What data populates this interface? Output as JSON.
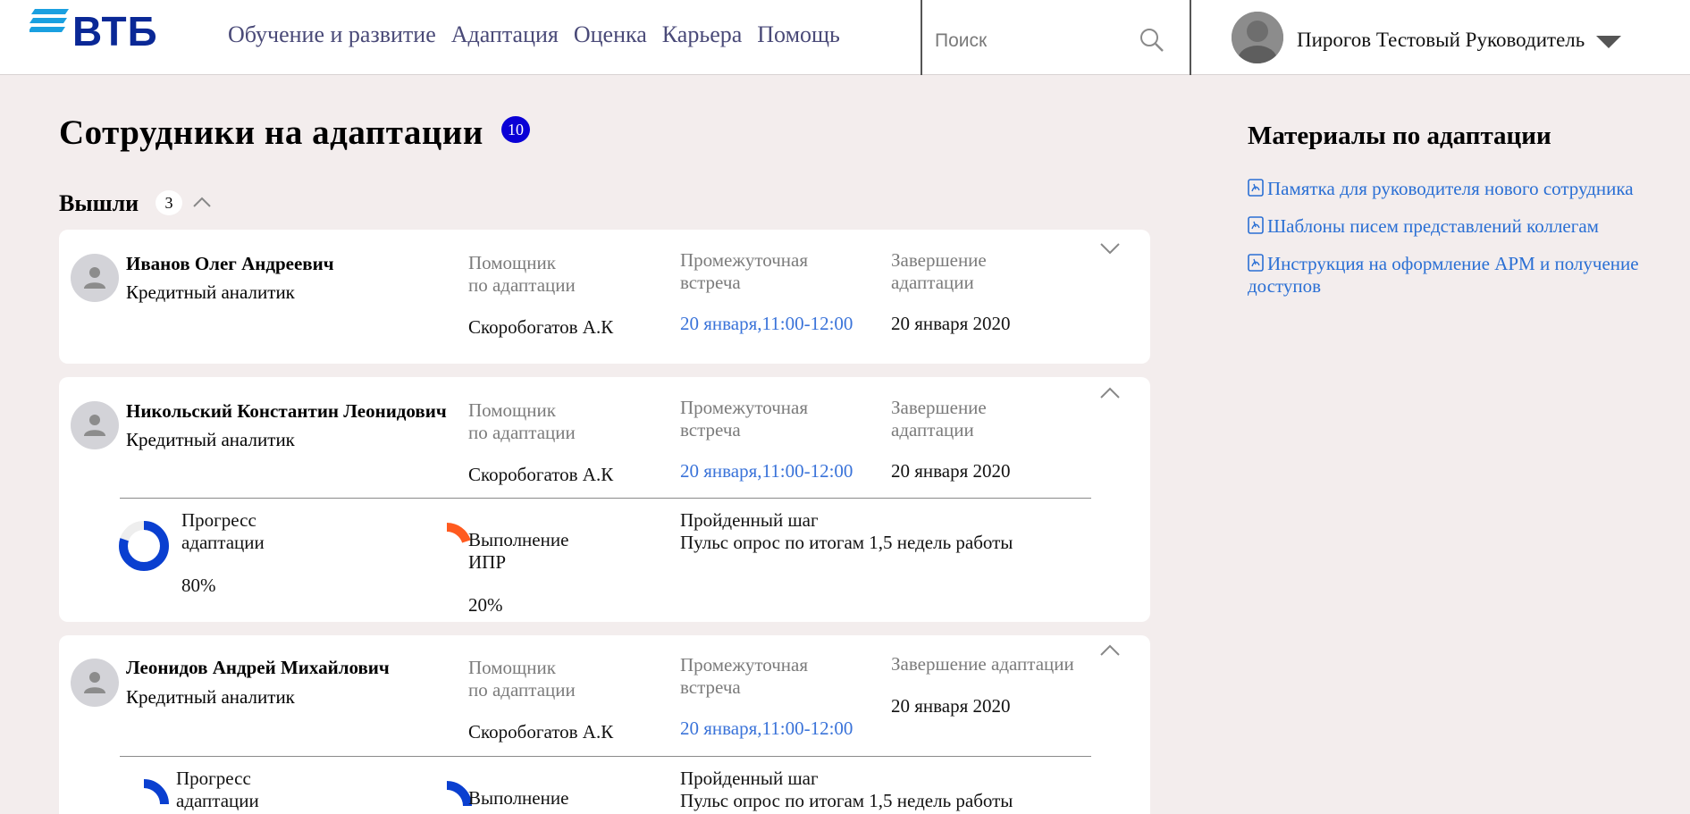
{
  "header": {
    "logo_text": "ВТБ",
    "nav": [
      "Обучение и развитие",
      "Адаптация",
      "Оценка",
      "Карьера",
      "Помощь"
    ],
    "search_placeholder": "Поиск",
    "user_name": "Пирогов Тестовый Руководитель"
  },
  "main": {
    "title": "Сотрудники на адаптации",
    "count": "10",
    "section": {
      "title": "Вышли",
      "count": "3"
    },
    "labels": {
      "helper": [
        "Помощник",
        "по адаптации"
      ],
      "meeting": [
        "Промежуточная",
        "встреча"
      ],
      "finish": [
        "Завершение",
        "адаптации"
      ],
      "finish_single": "Завершение адаптации",
      "progress": [
        "Прогресс",
        "адаптации"
      ],
      "ipr": [
        "Выполнение",
        "ИПР"
      ],
      "step": "Пройденный шаг"
    },
    "employees": [
      {
        "name": "Иванов Олег Андреевич",
        "role": "Кредитный аналитик",
        "helper": "Скоробогатов А.К",
        "meeting": "20 января,11:00-12:00",
        "finish": "20 января 2020",
        "expanded": false
      },
      {
        "name": "Никольский Константин Леонидович",
        "role": "Кредитный аналитик",
        "helper": "Скоробогатов А.К",
        "meeting": "20 января,11:00-12:00",
        "finish": "20 января 2020",
        "expanded": true,
        "progress": 80,
        "progress_text": "80%",
        "ipr": 20,
        "ipr_text": "20%",
        "step": "Пульс опрос по итогам 1,5 недель работы"
      },
      {
        "name": "Леонидов Андрей Михайлович",
        "role": "Кредитный аналитик",
        "helper": "Скоробогатов А.К",
        "meeting": "20 января,11:00-12:00",
        "finish": "20 января 2020",
        "expanded": true,
        "step": "Пульс опрос по итогам 1,5 недель работы"
      }
    ]
  },
  "sidebar": {
    "title": "Материалы по адаптации",
    "items": [
      "Памятка для руководителя нового сотрудника",
      "Шаблоны писем представлений коллегам",
      "Инструкция на оформление АРМ и получение доступов"
    ]
  },
  "colors": {
    "brand": "#0a2896",
    "brand_light": "#1aa0e0",
    "badge": "#0a00d6",
    "link": "#3a73d9",
    "progress": "#0a3fd0",
    "ipr": "#ff5a1f",
    "background": "#f3eded"
  }
}
